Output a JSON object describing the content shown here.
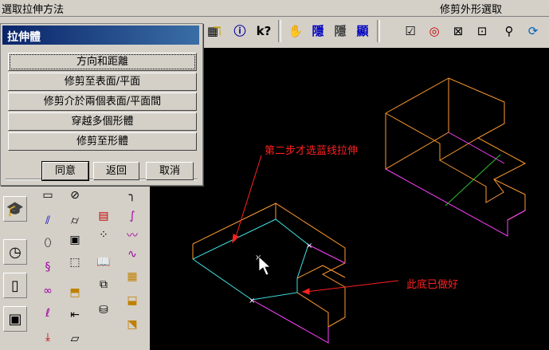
{
  "status_bar": {
    "left_text": "選取拉伸方法",
    "right_text": "修剪外形選取"
  },
  "toolbar_top_icons": [
    "grid-icon",
    "line-icon",
    "info-icon",
    "help-icon",
    "grip-icon",
    "hide-icon",
    "unhide-icon",
    "zoom-fit-icon",
    "view-select-icon",
    "render-icon",
    "zoom-window-icon",
    "zoom-extents-icon",
    "zoom-icon",
    "rotate-icon"
  ],
  "toolbar_second_icons": [
    "plus-icon",
    "surface-icon",
    "point-icon",
    "curve-icon",
    "shape-icon",
    "patch-icon",
    "sweep-icon",
    "ruled-icon",
    "loft-icon",
    "blend-icon",
    "fillet-icon",
    "cap-icon"
  ],
  "dialog": {
    "title": "拉伸體",
    "options": [
      "方向和距離",
      "修剪至表面/平面",
      "修剪介於兩個表面/平面間",
      "穿越多個形體",
      "修剪至形體"
    ],
    "buttons": {
      "ok": "同意",
      "back": "返回",
      "cancel": "取消"
    }
  },
  "annotations": {
    "step_two": "第二步才选蓝线拉伸",
    "bottom_done": "此底已做好"
  },
  "colors": {
    "canvas": "#000000",
    "orange_edge": "#ff9a30",
    "magenta_edge": "#ff40ff",
    "cyan_edge": "#40e0e0",
    "green_edge": "#30c030",
    "annotation": "#ff2020",
    "title_bar": "#0a246a"
  }
}
